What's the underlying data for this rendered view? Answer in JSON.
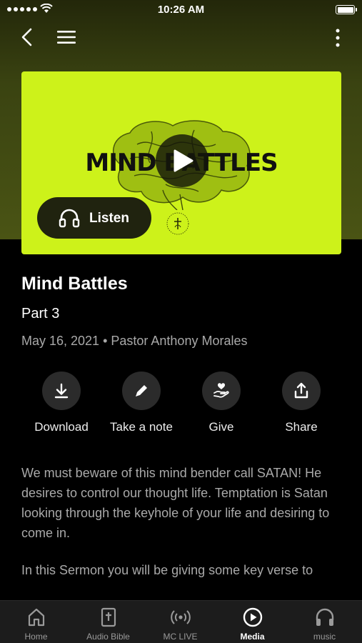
{
  "status_bar": {
    "time": "10:26 AM"
  },
  "nav": {
    "back_icon": "chevron-left-icon",
    "menu_icon": "hamburger-icon",
    "more_icon": "vertical-dots-icon"
  },
  "artwork": {
    "background": "#cdf21a",
    "title_text": "MIND BATTLES",
    "listen_label": "Listen"
  },
  "sermon": {
    "title": "Mind Battles",
    "part": "Part 3",
    "meta": "May 16, 2021 • Pastor Anthony Morales"
  },
  "actions": [
    {
      "label": "Download",
      "icon": "download-icon"
    },
    {
      "label": "Take a note",
      "icon": "pencil-icon"
    },
    {
      "label": "Give",
      "icon": "hand-heart-icon"
    },
    {
      "label": "Share",
      "icon": "share-icon"
    }
  ],
  "description": {
    "p1": "We must beware of this mind bender call SATAN! He desires to control our thought life. Temptation is Satan looking through the keyhole of your life and desiring to come in.",
    "p2": "In this Sermon you will be giving some key verse to"
  },
  "tabs": [
    {
      "label": "Home",
      "icon": "home-icon",
      "active": false
    },
    {
      "label": "Audio Bible",
      "icon": "bible-icon",
      "active": false
    },
    {
      "label": "MC LIVE",
      "icon": "broadcast-icon",
      "active": false
    },
    {
      "label": "Media",
      "icon": "play-circle-icon",
      "active": true
    },
    {
      "label": "music",
      "icon": "headphones-icon",
      "active": false
    }
  ]
}
